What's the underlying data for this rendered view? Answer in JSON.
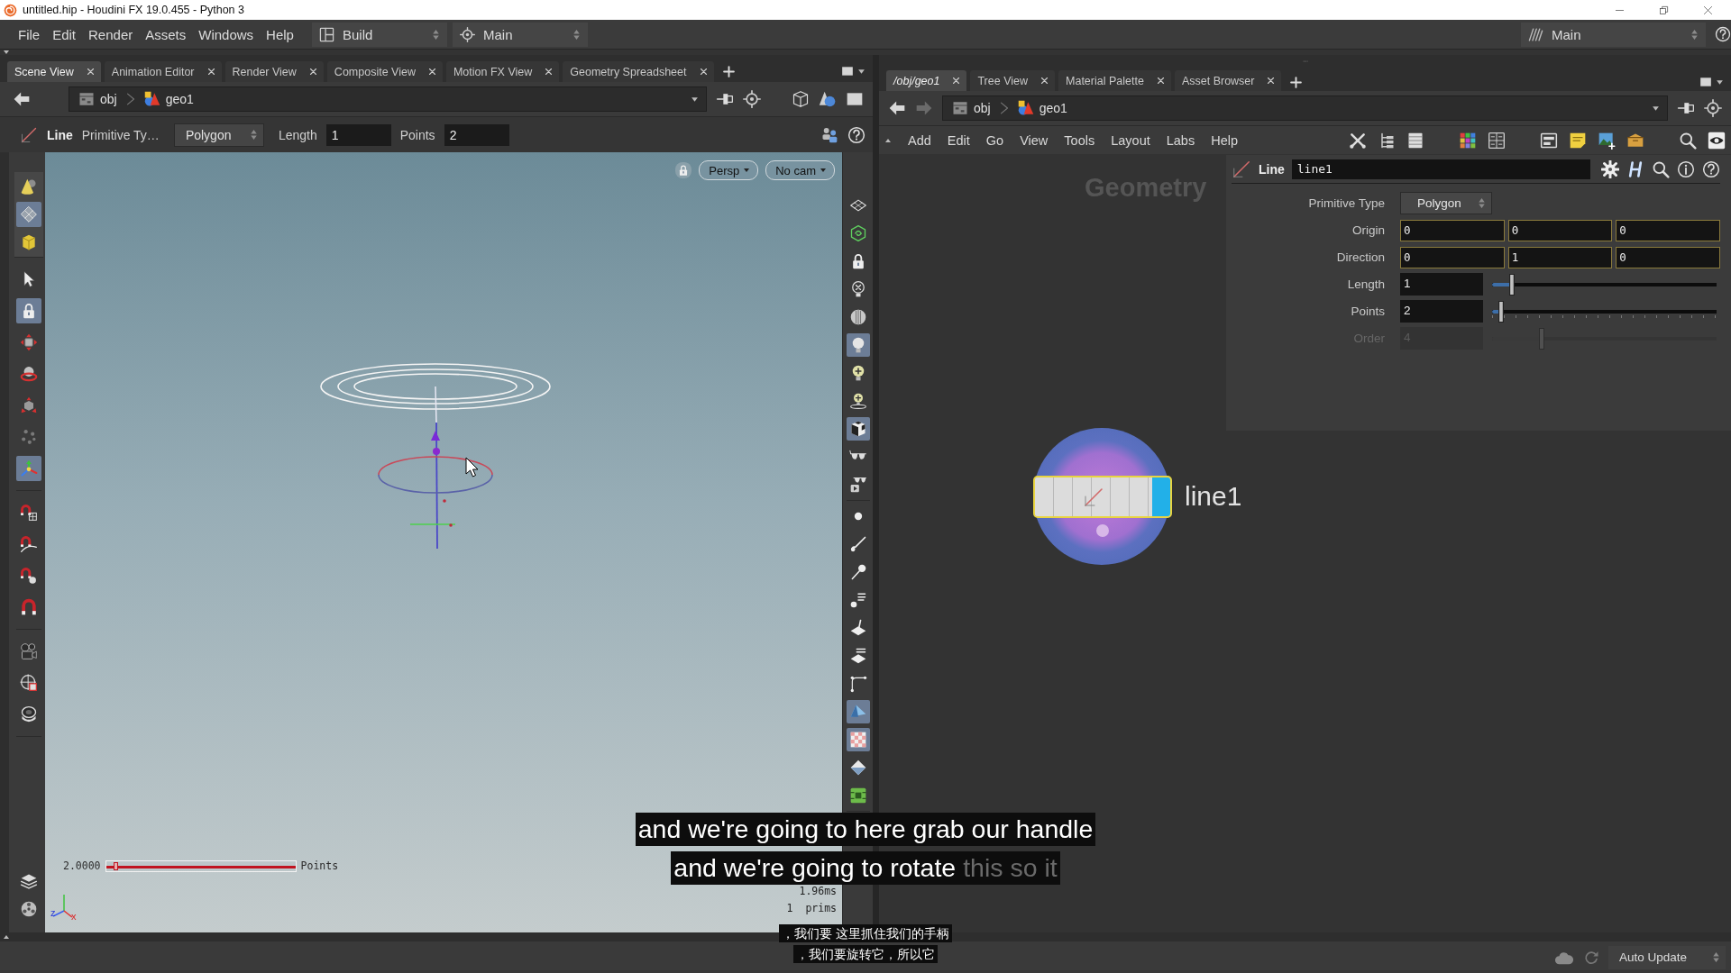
{
  "window": {
    "title": "untitled.hip - Houdini FX 19.0.455 - Python 3"
  },
  "menu_bar": {
    "items": [
      "File",
      "Edit",
      "Render",
      "Assets",
      "Windows",
      "Help"
    ],
    "desktop": "Build",
    "context": "Main",
    "right_context": "Main"
  },
  "scene_pane": {
    "tabs": [
      {
        "label": "Scene View",
        "selected": true
      },
      {
        "label": "Animation Editor",
        "selected": false
      },
      {
        "label": "Render View",
        "selected": false
      },
      {
        "label": "Composite View",
        "selected": false
      },
      {
        "label": "Motion FX View",
        "selected": false
      },
      {
        "label": "Geometry Spreadsheet",
        "selected": false
      }
    ],
    "path": [
      "obj",
      "geo1"
    ],
    "tool_options": {
      "node_type": "Line",
      "fields": [
        {
          "kind": "label",
          "text": "Primitive Ty…"
        },
        {
          "kind": "menu",
          "text": "Polygon"
        },
        {
          "kind": "label",
          "text": "Length"
        },
        {
          "kind": "input",
          "text": "1"
        },
        {
          "kind": "label",
          "text": "Points"
        },
        {
          "kind": "input",
          "text": "2"
        }
      ]
    },
    "left_toolbar": [
      [
        {
          "kind": "cone",
          "selected": false
        },
        {
          "kind": "diamond",
          "selected": true
        },
        {
          "kind": "cube",
          "selected": false
        }
      ],
      [
        {
          "kind": "arrow",
          "selected": false
        },
        {
          "kind": "lock",
          "selected": true
        },
        {
          "kind": "move",
          "selected": false
        },
        {
          "kind": "rotate",
          "selected": false
        },
        {
          "kind": "scale",
          "selected": false
        },
        {
          "kind": "scatter",
          "selected": false
        },
        {
          "kind": "handle",
          "selected": true
        }
      ],
      [
        {
          "kind": "magnet-grid",
          "selected": false
        },
        {
          "kind": "magnet-curve",
          "selected": false
        },
        {
          "kind": "magnet-ball",
          "selected": false
        },
        {
          "kind": "magnet",
          "selected": false
        }
      ],
      [
        {
          "kind": "camera",
          "selected": false
        },
        {
          "kind": "crosshair",
          "selected": false
        },
        {
          "kind": "lens",
          "selected": false
        }
      ],
      [
        {
          "kind": "layers",
          "selected": false
        },
        {
          "kind": "reel",
          "selected": false
        }
      ]
    ],
    "right_toolbar": [
      [
        {
          "kind": "plane",
          "selected": false
        },
        {
          "kind": "lasso",
          "selected": false
        },
        {
          "kind": "lock",
          "selected": false
        },
        {
          "kind": "bulb-x",
          "selected": false
        },
        {
          "kind": "sphere",
          "selected": false
        },
        {
          "kind": "bulb",
          "selected": true
        },
        {
          "kind": "bulb-plus",
          "selected": false
        },
        {
          "kind": "bulb-stand",
          "selected": false
        },
        {
          "kind": "checker-cube",
          "selected": true
        },
        {
          "kind": "glasses",
          "selected": false
        },
        {
          "kind": "glasses-play",
          "selected": false
        }
      ],
      [
        {
          "kind": "dot",
          "selected": false
        },
        {
          "kind": "brush",
          "selected": false
        },
        {
          "kind": "pin",
          "selected": false
        },
        {
          "kind": "dot-marks",
          "selected": false
        },
        {
          "kind": "shade",
          "selected": false
        },
        {
          "kind": "shade-marks",
          "selected": false
        },
        {
          "kind": "corner",
          "selected": false
        },
        {
          "kind": "plane-shade",
          "selected": true
        },
        {
          "kind": "checker",
          "selected": true
        },
        {
          "kind": "gem",
          "selected": false
        },
        {
          "kind": "frame",
          "selected": false
        }
      ]
    ],
    "view_buttons": [
      "Persp",
      "No cam"
    ],
    "handle_readout": {
      "value": "2.0000",
      "label": "Points",
      "level": 0.05
    },
    "axes": [
      "z",
      "x"
    ],
    "stats": [
      "1.96ms",
      "1  prims"
    ]
  },
  "network_pane": {
    "tabs": [
      {
        "label": "/obj/geo1",
        "selected": true
      },
      {
        "label": "Tree View",
        "selected": false
      },
      {
        "label": "Material Palette",
        "selected": false
      },
      {
        "label": "Asset Browser",
        "selected": false
      }
    ],
    "path": [
      "obj",
      "geo1"
    ],
    "menu": [
      "Add",
      "Edit",
      "Go",
      "View",
      "Tools",
      "Layout",
      "Labs",
      "Help"
    ],
    "network": {
      "context": "Geometry",
      "nodes": [
        {
          "name": "line1",
          "selected": true,
          "display": true
        }
      ]
    },
    "parameters": {
      "node_type": "Line",
      "node_name": "line1",
      "rows": [
        {
          "kind": "menu",
          "label": "Primitive Type",
          "value": "Polygon",
          "disabled": false
        },
        {
          "kind": "vector",
          "label": "Origin",
          "values": [
            "0",
            "0",
            "0"
          ],
          "disabled": false
        },
        {
          "kind": "vector",
          "label": "Direction",
          "values": [
            "0",
            "1",
            "0"
          ],
          "disabled": false
        },
        {
          "kind": "slider",
          "label": "Length",
          "value": "1",
          "level": 0.09,
          "disabled": false
        },
        {
          "kind": "slider",
          "label": "Points",
          "value": "2",
          "level": 0.04,
          "disabled": false
        },
        {
          "kind": "slider",
          "label": "Order",
          "value": "4",
          "level": 0.22,
          "disabled": true
        }
      ]
    }
  },
  "status_bar": {
    "update_mode": "Auto Update"
  },
  "captions": {
    "english": [
      {
        "segments": [
          {
            "text": "and we're going to here grab our handle",
            "dimmed": false
          }
        ]
      },
      {
        "segments": [
          {
            "text": "and we're going to rotate",
            "dimmed": false
          },
          {
            "text": "this so it",
            "dimmed": true
          }
        ]
      }
    ],
    "chinese": [
      "，我们要 这里抓住我们的手柄",
      "，我们要旋转它，所以它"
    ]
  }
}
